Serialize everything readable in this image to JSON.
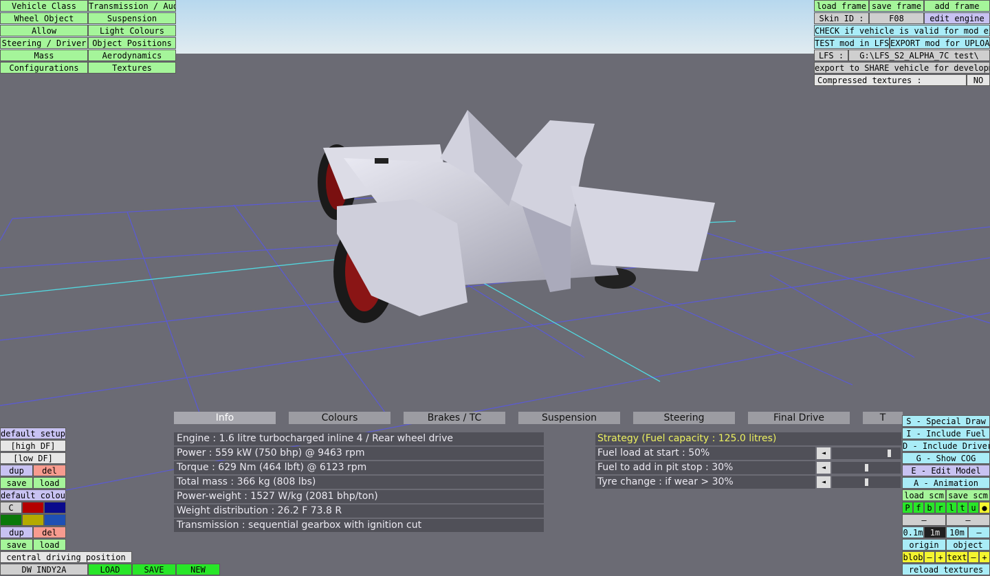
{
  "colors": {
    "sky": "#cfe3ee",
    "ground": "#6b6b74",
    "grid": "#5a5ad6",
    "axis": "#52d8e0",
    "button_green": "#a5f59a",
    "button_cyan": "#a9ecf7",
    "panel_dark": "#505058",
    "strategy_yellow": "#ecf060"
  },
  "top_left_menu": {
    "vehicle_class": "Vehicle Class",
    "transmission_audio": "Transmission / Audio",
    "wheel_object": "Wheel Object",
    "suspension": "Suspension",
    "allow": "Allow",
    "light_colours": "Light Colours",
    "steering_driver": "Steering / Driver",
    "object_positions": "Object Positions",
    "mass": "Mass",
    "aerodynamics": "Aerodynamics",
    "configurations": "Configurations",
    "textures": "Textures"
  },
  "top_right": {
    "load_frame": "load frame",
    "save_frame": "save frame",
    "add_frame": "add frame",
    "skin_id_label": "Skin ID :",
    "skin_id_value": "F08",
    "edit_engine": "edit engine",
    "check_valid": "CHECK if vehicle is valid for mod export",
    "test_mod": "TEST mod in LFS",
    "export_mod": "EXPORT mod for UPLOAD",
    "lfs_label": "LFS :",
    "lfs_path": "G:\\LFS_S2_ALPHA_7C test\\",
    "export_share": "export to SHARE vehicle for development",
    "compressed_label": "Compressed textures :",
    "compressed_value": "NO"
  },
  "tabs": [
    "Info",
    "Colours",
    "Brakes / TC",
    "Suspension",
    "Steering",
    "Final Drive",
    "T"
  ],
  "active_tab": "Info",
  "info_lines": [
    "Engine : 1.6 litre turbocharged inline 4 / Rear wheel drive",
    "Power : 559 kW (750 bhp) @ 9463 rpm",
    "Torque : 629 Nm (464 lbft) @ 6123 rpm",
    "Total mass : 366 kg (808 lbs)",
    "Power-weight : 1527 W/kg (2081 bhp/ton)",
    "Weight distribution : 26.2 F  73.8 R",
    "Transmission : sequential gearbox with ignition cut"
  ],
  "strategy": {
    "header": "Strategy (Fuel capacity : 125.0 litres)",
    "rows": [
      {
        "label": "Fuel load at start : 50%",
        "arrow": "◄",
        "fraction": 0.85
      },
      {
        "label": "Fuel to add in pit stop : 30%",
        "arrow": "◄",
        "fraction": 0.5
      },
      {
        "label": "Tyre change : if wear > 30%",
        "arrow": "◄",
        "fraction": 0.5
      }
    ]
  },
  "left_bottom": {
    "default_setups": "default setups",
    "high_df": "[high DF]",
    "low_df": "[low DF]",
    "dup": "dup",
    "del": "del",
    "save": "save",
    "load": "load",
    "default_colours": "default colours",
    "c": "C",
    "dup2": "dup",
    "del2": "del",
    "save2": "save",
    "load2": "load",
    "central_driving": "central driving position",
    "car_name": "DW INDY2A",
    "load_btn": "LOAD",
    "save_btn": "SAVE",
    "new_btn": "NEW",
    "swatches": [
      "#b40000",
      "#0a0a8c",
      "#0a780a",
      "#b4aa00",
      "#1e50b4"
    ]
  },
  "right_bottom": {
    "special_draw": "S - Special Draw",
    "include_fuel": "I - Include Fuel",
    "include_driver": "D - Include Driver",
    "show_cog": "G - Show COG",
    "edit_model": "E - Edit Model",
    "animation": "A - Animation",
    "load_scm": "load scm",
    "save_scm": "save scm",
    "letters": [
      "P",
      "f",
      "b",
      "r",
      "l",
      "t",
      "u",
      "●"
    ],
    "minus1": "–",
    "minus2": "–",
    "d01": "0.1m",
    "d1": "1m",
    "d10": "10m",
    "dminus": "–",
    "origin": "origin",
    "object": "object",
    "blob": "blob",
    "bminus": "–",
    "bplus": "+",
    "text": "text",
    "tminus": "–",
    "tplus": "+",
    "reload_textures": "reload textures"
  }
}
